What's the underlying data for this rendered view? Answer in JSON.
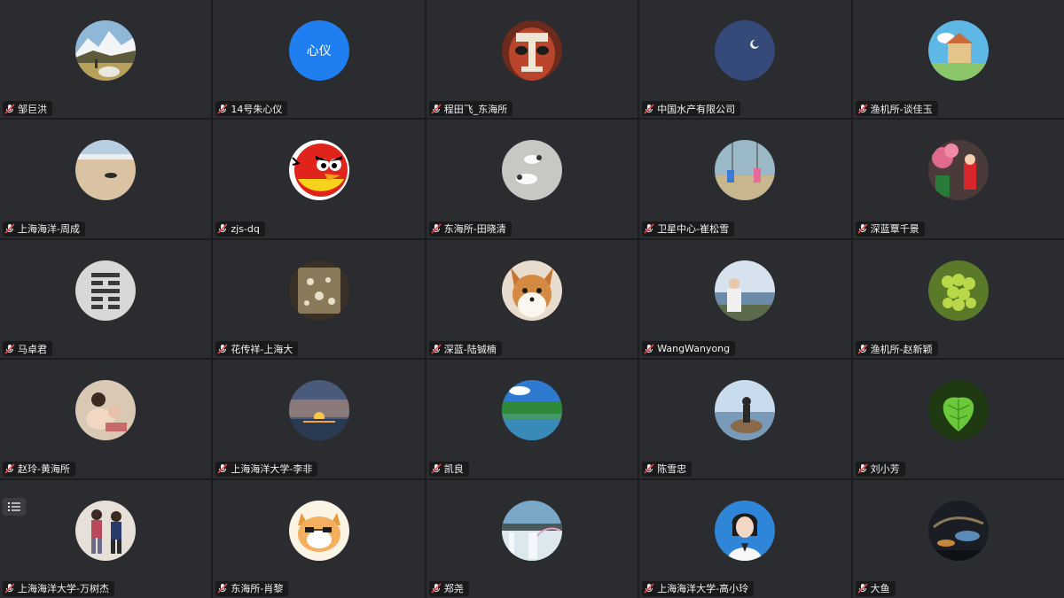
{
  "participants": [
    {
      "name": "邹巨洪"
    },
    {
      "name": "14号朱心仪",
      "avatar_text": "心仪"
    },
    {
      "name": "程田飞_东海所"
    },
    {
      "name": "中国水产有限公司"
    },
    {
      "name": "渔机所-谈佳玉"
    },
    {
      "name": "上海海洋-周成"
    },
    {
      "name": "zjs-dq"
    },
    {
      "name": "东海所-田晓清"
    },
    {
      "name": "卫星中心-崔松雪"
    },
    {
      "name": "深蓝覃千景"
    },
    {
      "name": "马卓君"
    },
    {
      "name": "花传祥-上海大"
    },
    {
      "name": "深蓝-陆铖楠"
    },
    {
      "name": "WangWanyong"
    },
    {
      "name": "渔机所-赵新颖"
    },
    {
      "name": "赵玲-黄海所"
    },
    {
      "name": "上海海洋大学-李非"
    },
    {
      "name": "凯良"
    },
    {
      "name": "陈雪忠"
    },
    {
      "name": "刘小芳"
    },
    {
      "name": "上海海洋大学-万树杰"
    },
    {
      "name": "东海所-肖黎"
    },
    {
      "name": "郑尧"
    },
    {
      "name": "上海海洋大学-高小玲"
    },
    {
      "name": "大鱼"
    }
  ],
  "icons": {
    "mic": "muted-mic-icon",
    "list": "list-icon"
  },
  "colors": {
    "tile_bg": "#2b2c2f",
    "accent_blue": "#1f7ff0",
    "mic_red": "#e04848"
  }
}
